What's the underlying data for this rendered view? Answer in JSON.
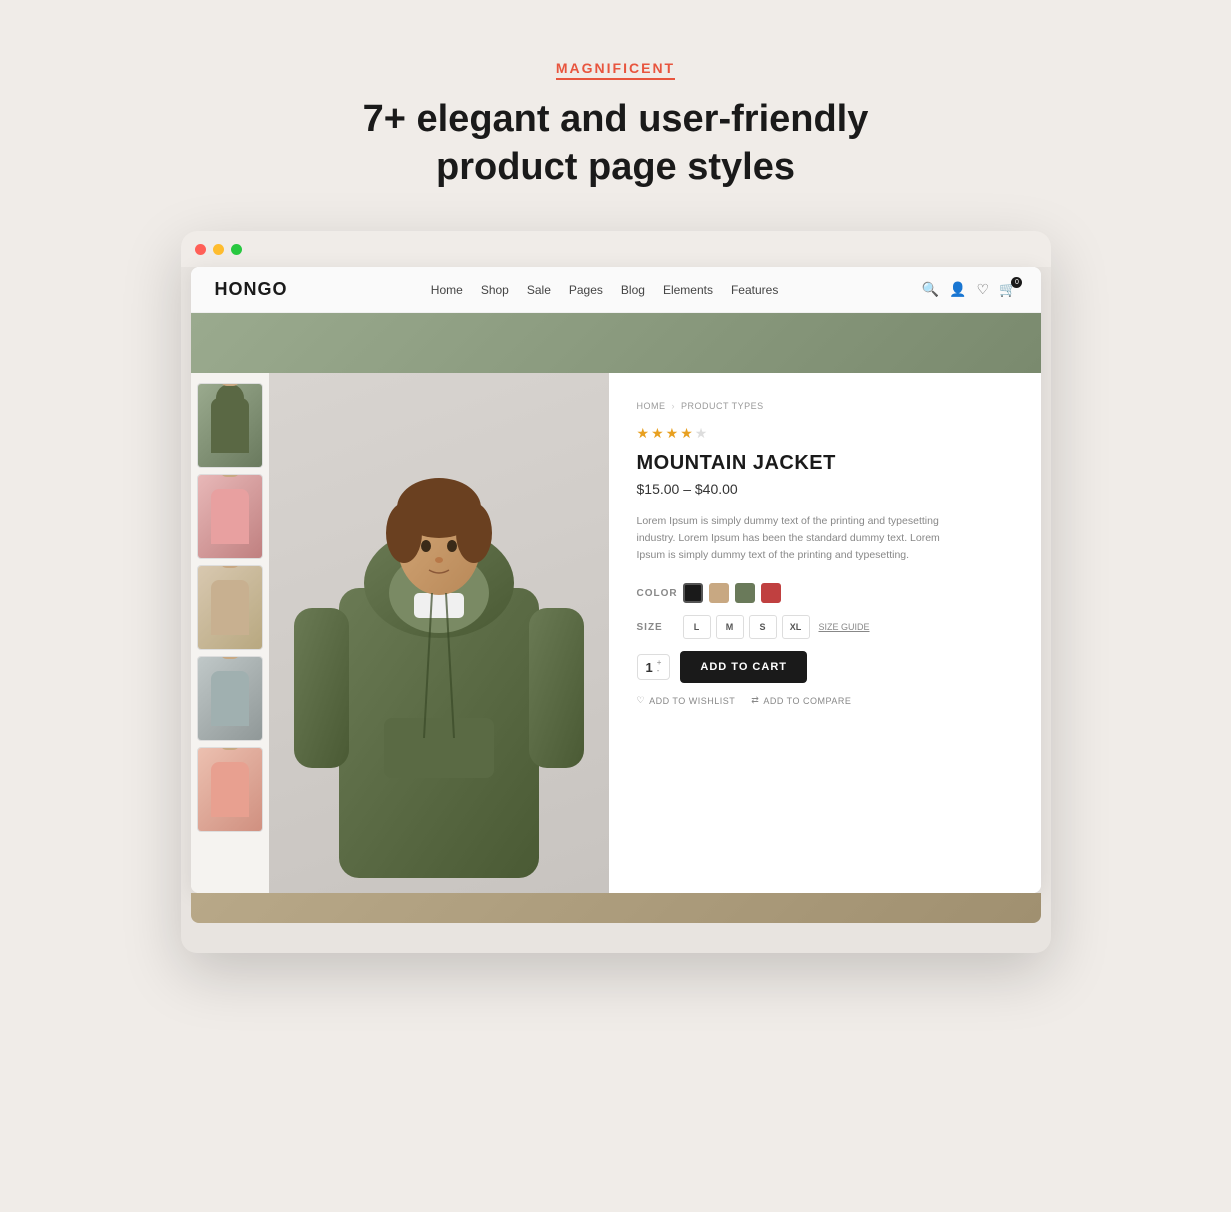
{
  "header": {
    "badge": "MAGNIFICENT",
    "title": "7+ elegant and user-friendly product page styles"
  },
  "browser": {
    "dots": [
      "red",
      "yellow",
      "green"
    ]
  },
  "nav": {
    "logo": "HONGO",
    "links": [
      "Home",
      "Shop",
      "Sale",
      "Pages",
      "Blog",
      "Elements",
      "Features"
    ],
    "cart_count": "0"
  },
  "product": {
    "breadcrumb": [
      "HOME",
      "PRODUCT TYPES"
    ],
    "rating": 4,
    "max_rating": 5,
    "name": "MOUNTAIN JACKET",
    "price_range": "$15.00 – $40.00",
    "description": "Lorem Ipsum is simply dummy text of the printing and typesetting industry. Lorem Ipsum has been the standard dummy text. Lorem Ipsum is simply dummy text of the printing and typesetting.",
    "color_label": "COLOR",
    "colors": [
      "black",
      "tan",
      "green",
      "red"
    ],
    "size_label": "SIZE",
    "sizes": [
      "L",
      "M",
      "S",
      "XL"
    ],
    "size_guide": "SIZE GUIDE",
    "quantity": "1",
    "add_to_cart": "ADD TO CART",
    "add_to_wishlist": "ADD TO WISHLIST",
    "add_to_compare": "ADD TO COMPARE"
  }
}
